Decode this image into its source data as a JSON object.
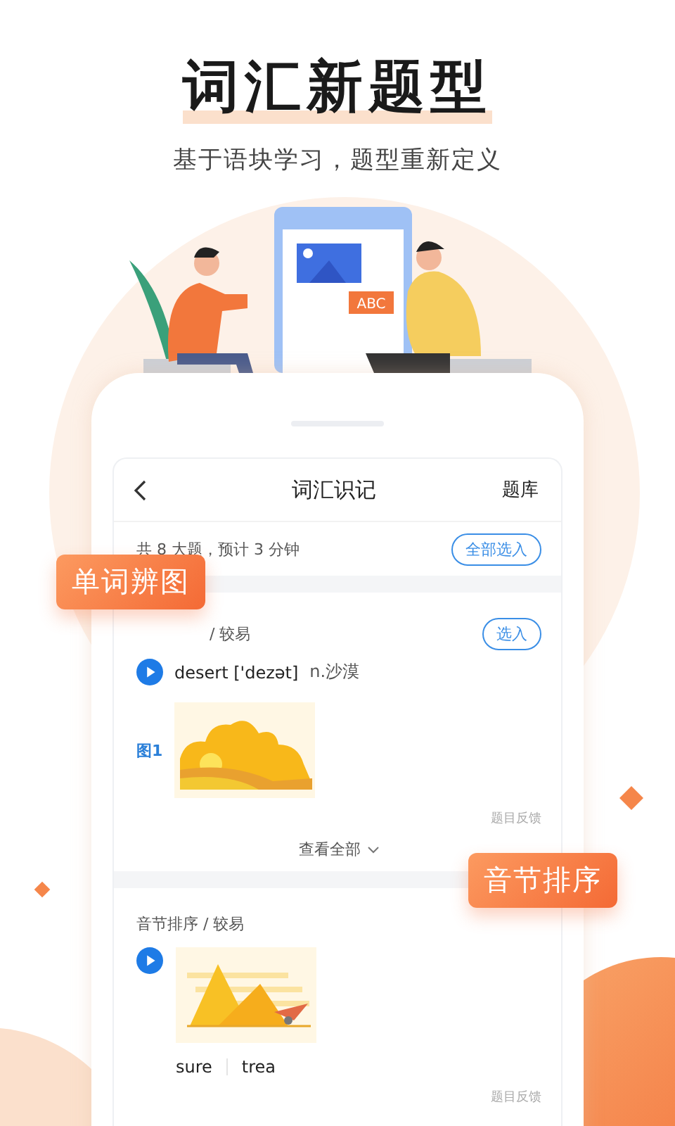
{
  "headline": "词汇新题型",
  "subtitle": "基于语块学习，题型重新定义",
  "illustration": {
    "tag": "ABC"
  },
  "feature_tags": [
    {
      "label": "单词辨图"
    },
    {
      "label": "音节排序"
    }
  ],
  "app": {
    "title": "词汇识记",
    "action": "题库"
  },
  "summary": {
    "text": "共 8 大题，预计 3 分钟",
    "button": "全部选入"
  },
  "questions": [
    {
      "kind": "picture",
      "label": "/ 较易",
      "select_button": "选入",
      "word": "desert",
      "phonetic": "['dezət]",
      "meaning": "n.沙漠",
      "image_label": "图1",
      "feedback": "题目反馈",
      "more": "查看全部"
    },
    {
      "kind": "syllable",
      "label": "音节排序 / 较易",
      "syllables": [
        "sure",
        "trea"
      ],
      "feedback": "题目反馈"
    }
  ]
}
